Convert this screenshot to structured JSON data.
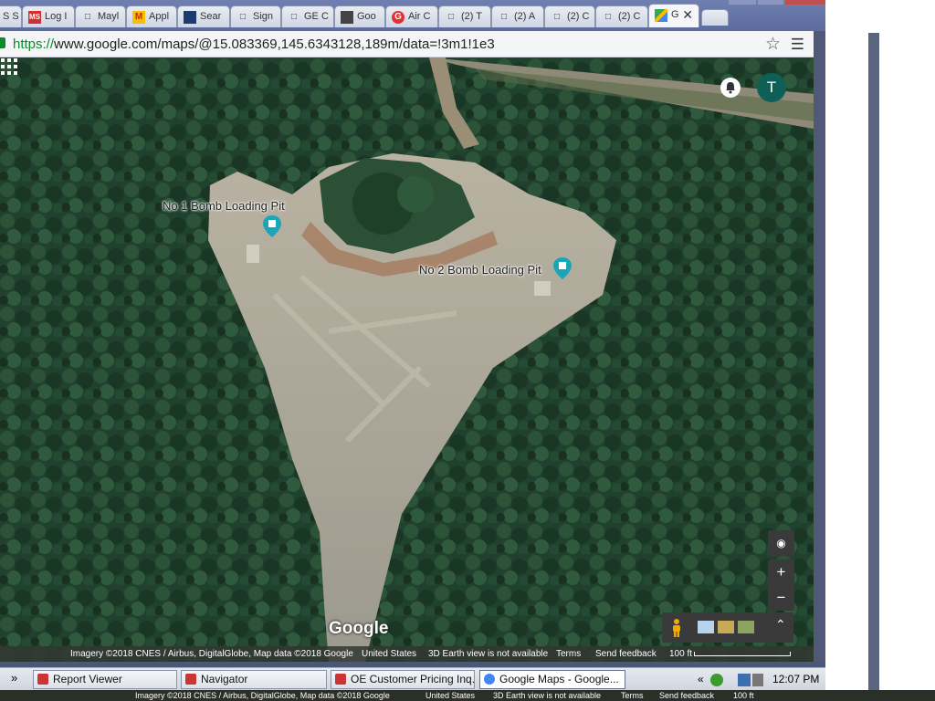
{
  "browser": {
    "tabs": [
      {
        "label": "S S",
        "favicon": ""
      },
      {
        "label": "Log I",
        "favicon": "MS"
      },
      {
        "label": "Mayl",
        "favicon": "doc"
      },
      {
        "label": "Appl",
        "favicon": "M"
      },
      {
        "label": "Sear",
        "favicon": "ship"
      },
      {
        "label": "Sign",
        "favicon": "doc"
      },
      {
        "label": "GE C",
        "favicon": "doc"
      },
      {
        "label": "Goo",
        "favicon": "img"
      },
      {
        "label": "Air C",
        "favicon": "G"
      },
      {
        "label": "(2) T",
        "favicon": "doc"
      },
      {
        "label": "(2) A",
        "favicon": "doc"
      },
      {
        "label": "(2) C",
        "favicon": "doc"
      },
      {
        "label": "(2) C",
        "favicon": "doc"
      },
      {
        "label": "G",
        "favicon": "maps",
        "active": true
      }
    ],
    "url_scheme": "https://",
    "url_rest": "www.google.com/maps/@15.083369,145.6343128,189m/data=!3m1!1e3"
  },
  "map": {
    "pois": [
      {
        "label": "No 1 Bomb Loading Pit"
      },
      {
        "label": "No 2 Bomb Loading Pit"
      }
    ],
    "account_initial": "T",
    "logo": "Google",
    "footer": {
      "imagery": "Imagery ©2018 CNES / Airbus, DigitalGlobe, Map data ©2018 Google",
      "region": "United States",
      "earth_view": "3D Earth view is not available",
      "terms": "Terms",
      "feedback": "Send feedback",
      "scale": "100 ft"
    },
    "zoom_in": "+",
    "zoom_out": "−"
  },
  "taskbar": {
    "chevron": "»",
    "items": [
      {
        "label": "Report Viewer"
      },
      {
        "label": "Navigator"
      },
      {
        "label": "OE Customer Pricing Inq..."
      },
      {
        "label": "Google Maps - Google...",
        "active": true
      }
    ],
    "tray_chevron": "«",
    "clock": "12:07 PM"
  },
  "bottom_strip": {
    "imagery": "Imagery ©2018 CNES / Airbus, DigitalGlobe, Map data ©2018 Google",
    "region": "United States",
    "earth_view": "3D Earth view is not available",
    "terms": "Terms",
    "feedback": "Send feedback",
    "scale": "100 ft"
  },
  "colors": {
    "forest": "#1f3f30",
    "clearing": "#a6a395",
    "avatar": "#0e5f56",
    "poi_pin": "#1aa6b7",
    "https_green": "#0a8a2a"
  }
}
